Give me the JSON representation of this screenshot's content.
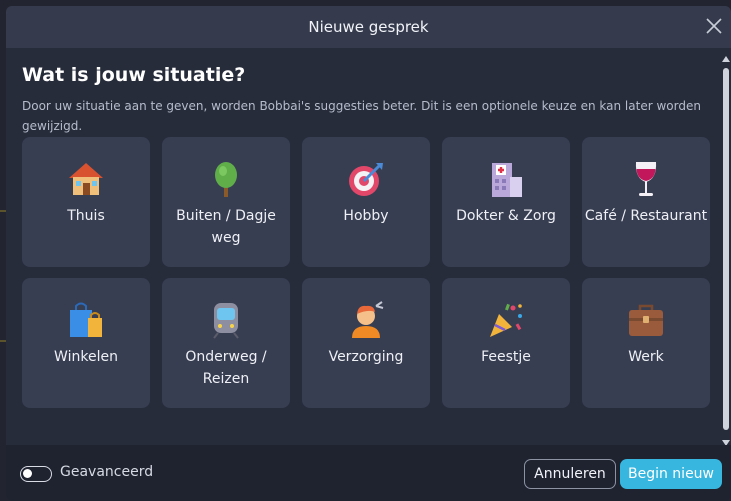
{
  "dialog": {
    "title": "Nieuwe gesprek",
    "heading": "Wat is jouw situatie?",
    "description": "Door uw situatie aan te geven, worden Bobbai's suggesties beter. Dit is een optionele keuze en kan later worden gewijzigd."
  },
  "situations": [
    {
      "label": "Thuis",
      "icon": "house-icon"
    },
    {
      "label": "Buiten / Dagje weg",
      "icon": "tree-icon"
    },
    {
      "label": "Hobby",
      "icon": "dart-target-icon"
    },
    {
      "label": "Dokter & Zorg",
      "icon": "hospital-icon"
    },
    {
      "label": "Café / Restaurant",
      "icon": "wine-glass-icon"
    },
    {
      "label": "Winkelen",
      "icon": "shopping-bags-icon"
    },
    {
      "label": "Onderweg / Reizen",
      "icon": "train-icon"
    },
    {
      "label": "Verzorging",
      "icon": "haircut-icon"
    },
    {
      "label": "Feestje",
      "icon": "party-popper-icon"
    },
    {
      "label": "Werk",
      "icon": "briefcase-icon"
    }
  ],
  "footer": {
    "advanced_label": "Geavanceerd",
    "advanced_enabled": false,
    "cancel_label": "Annuleren",
    "start_label": "Begin nieuw"
  },
  "colors": {
    "accent": "#37b6e0",
    "dialog_bg": "#272c3b",
    "tile_bg": "#383e52"
  }
}
